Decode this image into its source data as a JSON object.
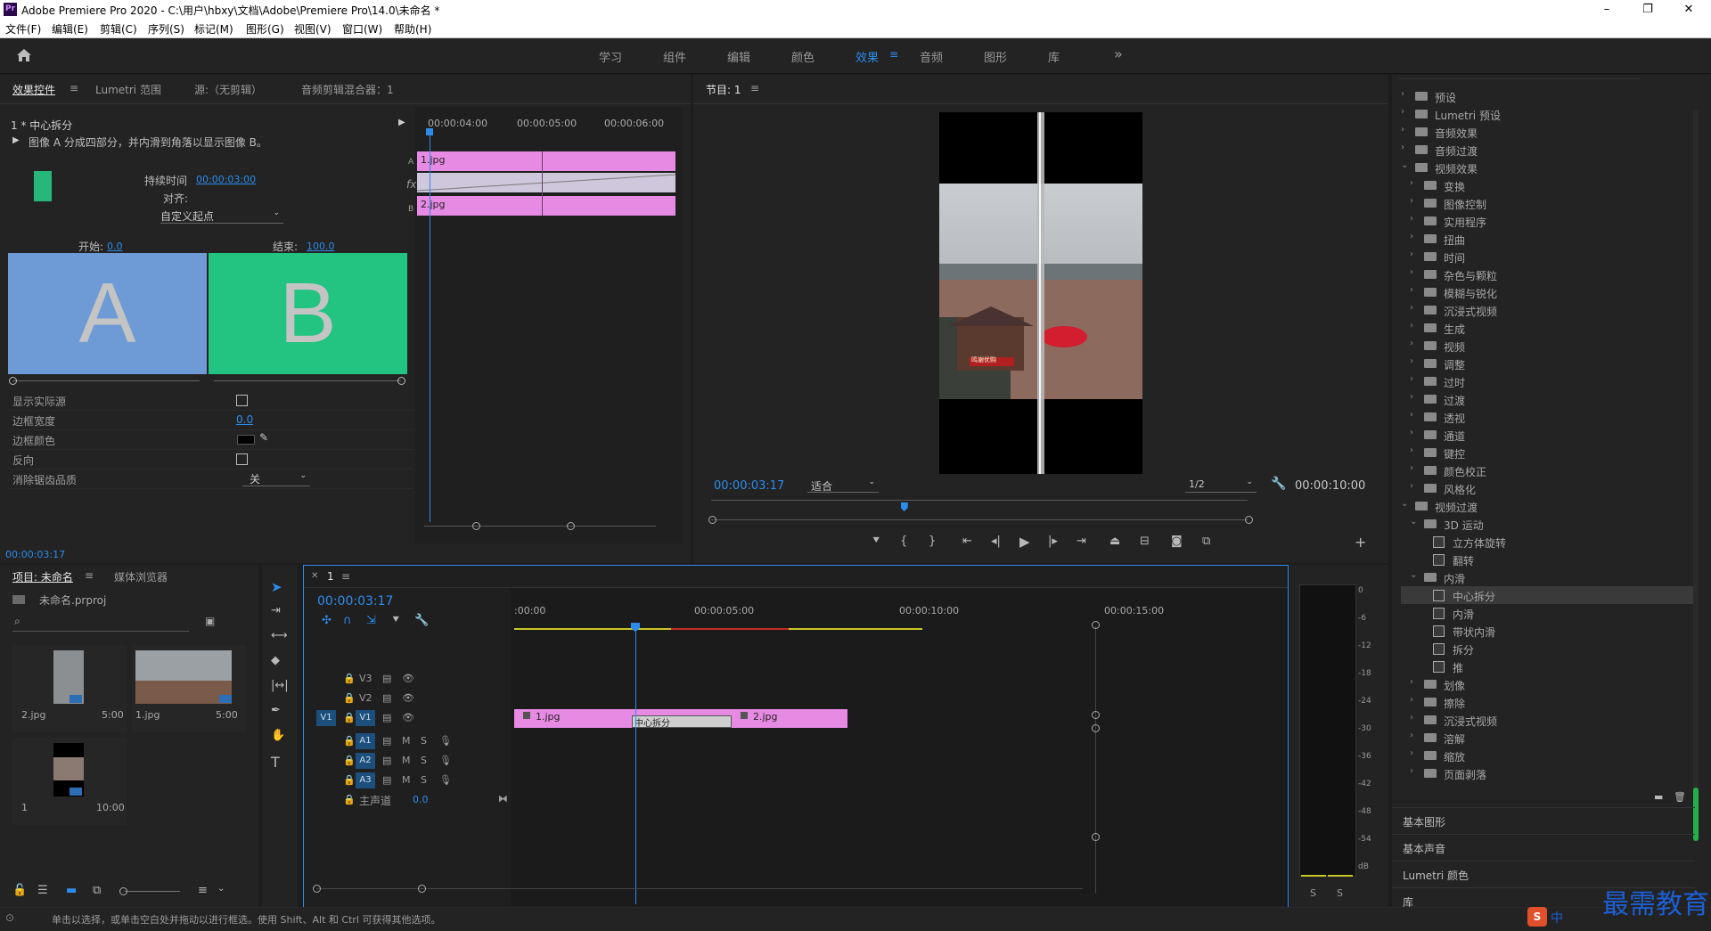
{
  "window": {
    "title": "Adobe Premiere Pro 2020 - C:\\用户\\hbxy\\文档\\Adobe\\Premiere Pro\\14.0\\未命名 *",
    "app_icon": "Pr",
    "minimize": "–",
    "maximize": "❐",
    "close": "✕"
  },
  "menu": [
    "文件(F)",
    "编辑(E)",
    "剪辑(C)",
    "序列(S)",
    "标记(M)",
    "图形(G)",
    "视图(V)",
    "窗口(W)",
    "帮助(H)"
  ],
  "workspaces": {
    "items": [
      "学习",
      "组件",
      "编辑",
      "颜色",
      "效果",
      "音频",
      "图形",
      "库"
    ],
    "active": "效果",
    "more": "»"
  },
  "effect_controls": {
    "tabs": [
      "效果控件",
      "Lumetri 范围",
      "源:（无剪辑）",
      "音频剪辑混合器：1"
    ],
    "clip_name": "1 * 中心拆分",
    "description": "图像 A 分成四部分，并内滑到角落以显示图像 B。",
    "duration_label": "持续时间",
    "duration_value": "00:00:03:00",
    "align_label": "对齐:",
    "align_value": "自定义起点",
    "start_label": "开始:",
    "start_value": "0.0",
    "end_label": "结束:",
    "end_value": "100.0",
    "preview_a": "A",
    "preview_b": "B",
    "props": [
      {
        "label": "显示实际源",
        "value": ""
      },
      {
        "label": "边框宽度",
        "value": "0.0"
      },
      {
        "label": "边框颜色",
        "value": ""
      },
      {
        "label": "反向",
        "value": ""
      },
      {
        "label": "消除锯齿品质",
        "value": "关"
      }
    ],
    "timecode": "00:00:03:17",
    "ruler": [
      "00:00:04:00",
      "00:00:05:00",
      "00:00:06:00"
    ],
    "track_a": "A",
    "track_b": "B",
    "fx": "fx",
    "clip_a": "1.jpg",
    "clip_b": "2.jpg"
  },
  "program": {
    "title": "节目: 1",
    "timecode": "00:00:03:17",
    "fit": "适合",
    "resolution": "1/2",
    "duration": "00:00:10:00",
    "sign_text": "鸣谢优购",
    "playhead_fraction": 0.36
  },
  "project": {
    "tabs": [
      "项目: 未命名",
      "媒体浏览器"
    ],
    "file": "未命名.prproj",
    "items": [
      {
        "name": "2.jpg",
        "duration": "5:00"
      },
      {
        "name": "1.jpg",
        "duration": "5:00"
      },
      {
        "name": "1",
        "duration": "10:00"
      }
    ]
  },
  "timeline": {
    "tab": "1",
    "timecode": "00:00:03:17",
    "ruler": [
      ":00:00",
      "00:00:05:00",
      "00:00:10:00",
      "00:00:15:00"
    ],
    "tracks_video": [
      "V3",
      "V2",
      "V1"
    ],
    "tracks_audio": [
      "A1",
      "A2",
      "A3"
    ],
    "source_v1": "V1",
    "master_label": "主声道",
    "master_value": "0.0",
    "clip1": "1.jpg",
    "clip2": "2.jpg",
    "transition": "中心拆分",
    "m": "M",
    "s": "S"
  },
  "effects_panel": {
    "tree": [
      {
        "level": 0,
        "type": "folder",
        "expanded": false,
        "label": "预设"
      },
      {
        "level": 0,
        "type": "folder",
        "expanded": false,
        "label": "Lumetri 预设"
      },
      {
        "level": 0,
        "type": "folder",
        "expanded": false,
        "label": "音频效果"
      },
      {
        "level": 0,
        "type": "folder",
        "expanded": false,
        "label": "音频过渡"
      },
      {
        "level": 0,
        "type": "folder",
        "expanded": true,
        "label": "视频效果"
      },
      {
        "level": 1,
        "type": "folder",
        "expanded": false,
        "label": "变换"
      },
      {
        "level": 1,
        "type": "folder",
        "expanded": false,
        "label": "图像控制"
      },
      {
        "level": 1,
        "type": "folder",
        "expanded": false,
        "label": "实用程序"
      },
      {
        "level": 1,
        "type": "folder",
        "expanded": false,
        "label": "扭曲"
      },
      {
        "level": 1,
        "type": "folder",
        "expanded": false,
        "label": "时间"
      },
      {
        "level": 1,
        "type": "folder",
        "expanded": false,
        "label": "杂色与颗粒"
      },
      {
        "level": 1,
        "type": "folder",
        "expanded": false,
        "label": "模糊与锐化"
      },
      {
        "level": 1,
        "type": "folder",
        "expanded": false,
        "label": "沉浸式视频"
      },
      {
        "level": 1,
        "type": "folder",
        "expanded": false,
        "label": "生成"
      },
      {
        "level": 1,
        "type": "folder",
        "expanded": false,
        "label": "视频"
      },
      {
        "level": 1,
        "type": "folder",
        "expanded": false,
        "label": "调整"
      },
      {
        "level": 1,
        "type": "folder",
        "expanded": false,
        "label": "过时"
      },
      {
        "level": 1,
        "type": "folder",
        "expanded": false,
        "label": "过渡"
      },
      {
        "level": 1,
        "type": "folder",
        "expanded": false,
        "label": "透视"
      },
      {
        "level": 1,
        "type": "folder",
        "expanded": false,
        "label": "通道"
      },
      {
        "level": 1,
        "type": "folder",
        "expanded": false,
        "label": "键控"
      },
      {
        "level": 1,
        "type": "folder",
        "expanded": false,
        "label": "颜色校正"
      },
      {
        "level": 1,
        "type": "folder",
        "expanded": false,
        "label": "风格化"
      },
      {
        "level": 0,
        "type": "folder",
        "expanded": true,
        "label": "视频过渡"
      },
      {
        "level": 1,
        "type": "folder",
        "expanded": true,
        "label": "3D 运动"
      },
      {
        "level": 2,
        "type": "preset",
        "label": "立方体旋转"
      },
      {
        "level": 2,
        "type": "preset",
        "label": "翻转"
      },
      {
        "level": 1,
        "type": "folder",
        "expanded": true,
        "label": "内滑"
      },
      {
        "level": 2,
        "type": "preset",
        "label": "中心拆分",
        "selected": true
      },
      {
        "level": 2,
        "type": "preset",
        "label": "内滑"
      },
      {
        "level": 2,
        "type": "preset",
        "label": "带状内滑"
      },
      {
        "level": 2,
        "type": "preset",
        "label": "拆分"
      },
      {
        "level": 2,
        "type": "preset",
        "label": "推"
      },
      {
        "level": 1,
        "type": "folder",
        "expanded": false,
        "label": "划像"
      },
      {
        "level": 1,
        "type": "folder",
        "expanded": false,
        "label": "擦除"
      },
      {
        "level": 1,
        "type": "folder",
        "expanded": false,
        "label": "沉浸式视频"
      },
      {
        "level": 1,
        "type": "folder",
        "expanded": false,
        "label": "溶解"
      },
      {
        "level": 1,
        "type": "folder",
        "expanded": false,
        "label": "缩放"
      },
      {
        "level": 1,
        "type": "folder",
        "expanded": false,
        "label": "页面剥落"
      }
    ],
    "sections": [
      "基本图形",
      "基本声音",
      "Lumetri 颜色",
      "库"
    ]
  },
  "audio_meter": {
    "scale": [
      "0",
      "-6",
      "-12",
      "-18",
      "-24",
      "-30",
      "-36",
      "-42",
      "-48",
      "-54",
      "dB"
    ],
    "solo": [
      "S",
      "S"
    ]
  },
  "status": {
    "text": "单击以选择，或单击空白处并拖动以进行框选。使用 Shift、Alt 和 Ctrl 可获得其他选项。"
  },
  "watermark": {
    "text": "最需教育",
    "ime": "中"
  },
  "colors": {
    "accent": "#2d8ceb",
    "clip_pink": "#e78ae3",
    "preview_a": "#6e9bd6",
    "preview_b": "#23c381"
  }
}
